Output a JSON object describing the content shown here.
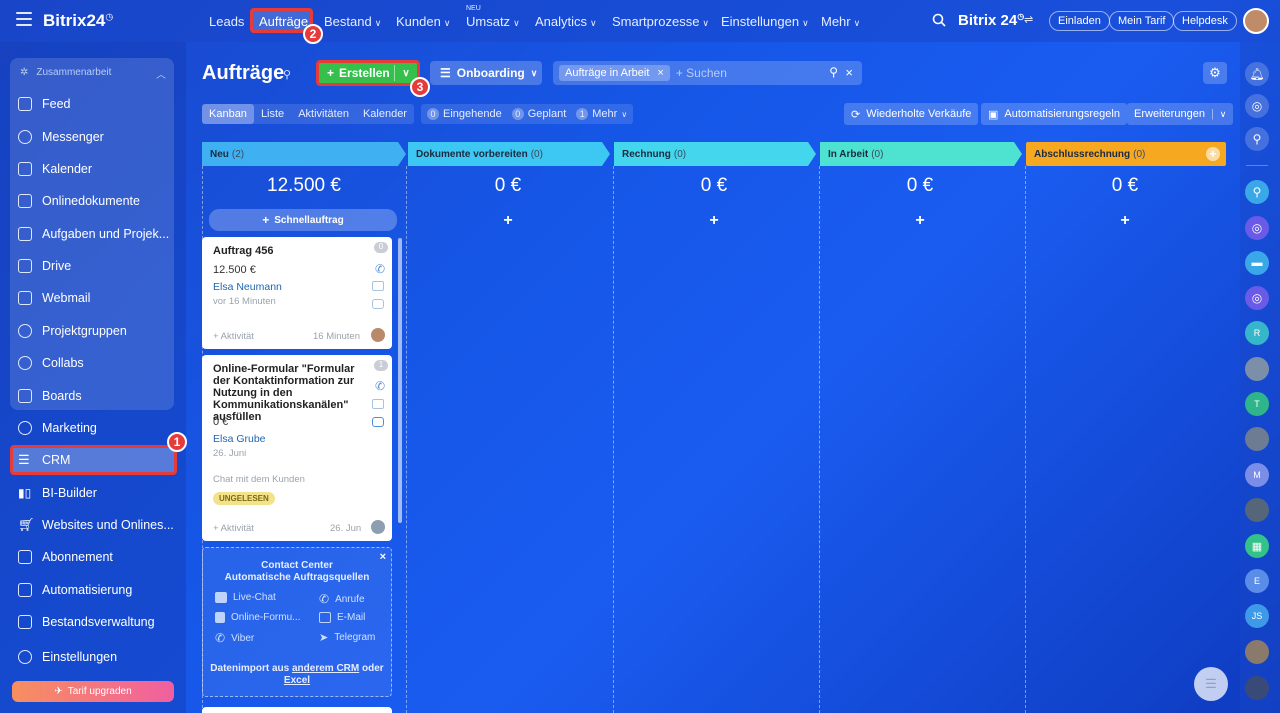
{
  "topbar": {
    "logo": "Bitrix24",
    "nav": [
      {
        "label": "Leads",
        "chevron": false
      },
      {
        "label": "Aufträge",
        "chevron": false
      },
      {
        "label": "Bestand",
        "chevron": true
      },
      {
        "label": "Kunden",
        "chevron": true
      },
      {
        "label": "Umsatz",
        "chevron": true
      },
      {
        "label": "Analytics",
        "chevron": true
      },
      {
        "label": "Smartprozesse",
        "chevron": true
      },
      {
        "label": "Einstellungen",
        "chevron": true
      },
      {
        "label": "Mehr",
        "chevron": true
      }
    ],
    "new_tag": "NEU",
    "brand": "Bitrix 24",
    "invite": "Einladen",
    "my_plan": "Mein Tarif",
    "helpdesk": "Helpdesk"
  },
  "sidebar": {
    "group_title": "Zusammenarbeit",
    "group_items": [
      "Feed",
      "Messenger",
      "Kalender",
      "Onlinedokumente",
      "Aufgaben und Projek...",
      "Drive",
      "Webmail",
      "Projektgruppen",
      "Collabs",
      "Boards"
    ],
    "items": [
      "Marketing",
      "CRM",
      "BI-Builder",
      "Websites und Onlines...",
      "Abonnement",
      "Automatisierung",
      "Bestandsverwaltung",
      "Einstellungen"
    ],
    "upgrade": "Tarif upgraden"
  },
  "markers": {
    "m1": "1",
    "m2": "2",
    "m3": "3"
  },
  "header": {
    "title": "Aufträge",
    "create": "Erstellen",
    "onboarding": "Onboarding",
    "filter_chip": "Aufträge in Arbeit",
    "search_placeholder": "+ Suchen"
  },
  "view_tabs": [
    "Kanban",
    "Liste",
    "Aktivitäten",
    "Kalender"
  ],
  "counters": [
    {
      "count": "0",
      "label": "Eingehende"
    },
    {
      "count": "0",
      "label": "Geplant"
    },
    {
      "count": "1",
      "label": "Mehr"
    }
  ],
  "toolbar": {
    "repeat_sales": "Wiederholte Verkäufe",
    "automation": "Automatisierungsregeln",
    "extensions": "Erweiterungen"
  },
  "columns": [
    {
      "name": "Neu",
      "count": "(2)",
      "sum": "12.500 €",
      "color": "#3fb1f2"
    },
    {
      "name": "Dokumente vorbereiten",
      "count": "(0)",
      "sum": "0 €",
      "color": "#3cc8f2"
    },
    {
      "name": "Rechnung",
      "count": "(0)",
      "sum": "0 €",
      "color": "#43d6ec"
    },
    {
      "name": "In Arbeit",
      "count": "(0)",
      "sum": "0 €",
      "color": "#4ee3d0"
    },
    {
      "name": "Abschlussrechnung",
      "count": "(0)",
      "sum": "0 €",
      "color": "#f7a821"
    }
  ],
  "quick_deal": "Schnellauftrag",
  "cards": [
    {
      "title": "Auftrag 456",
      "sum": "12.500 €",
      "contact": "Elsa Neumann",
      "date": "vor 16 Minuten",
      "activity": "+ Aktivität",
      "time": "16 Minuten",
      "counter": "0"
    },
    {
      "title": "Online-Formular \"Formular der Kontaktinformation zur Nutzung in den Kommunikationskanälen\" ausfüllen",
      "sum": "0 €",
      "contact": "Elsa Grube",
      "date": "26. Juni",
      "chat": "Chat mit dem Kunden",
      "status": "UNGELESEN",
      "activity": "+ Aktivität",
      "time": "26. Jun",
      "counter": "1"
    }
  ],
  "contact_center": {
    "title": "Contact Center",
    "subtitle": "Automatische Auftragsquellen",
    "sources": [
      "Live-Chat",
      "Anrufe",
      "Online-Formu...",
      "E-Mail",
      "Viber",
      "Telegram"
    ],
    "import_text": "Datenimport aus",
    "import_link1": "anderem CRM",
    "import_or": "oder",
    "import_link2": "Excel"
  },
  "rail_letters": [
    "R",
    "T",
    "M",
    "E",
    "JS"
  ]
}
